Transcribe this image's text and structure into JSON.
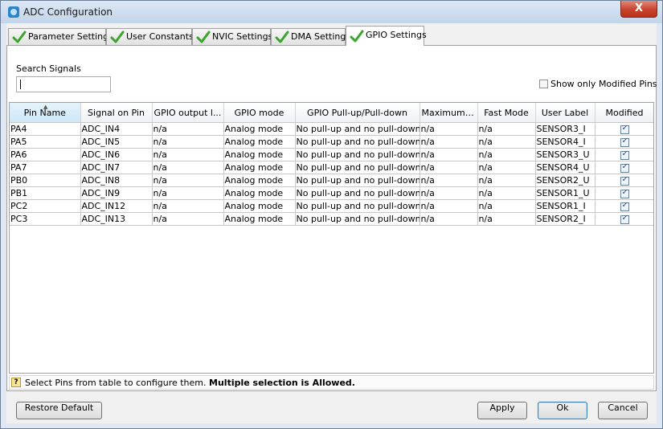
{
  "window": {
    "title": "ADC Configuration",
    "close_label": "X"
  },
  "tabs": [
    {
      "label": "Parameter Settings",
      "active": false
    },
    {
      "label": "User Constants",
      "active": false
    },
    {
      "label": "NVIC Settings",
      "active": false
    },
    {
      "label": "DMA Settings",
      "active": false
    },
    {
      "label": "GPIO Settings",
      "active": true
    }
  ],
  "search": {
    "label": "Search Signals",
    "value": ""
  },
  "show_modified": {
    "label": "Show only Modified Pins",
    "checked": false
  },
  "table": {
    "columns": [
      "Pin Name",
      "Signal on Pin",
      "GPIO output l...",
      "GPIO mode",
      "GPIO Pull-up/Pull-down",
      "Maximum ...",
      "Fast Mode",
      "User Label",
      "Modified"
    ],
    "sorted_column": "Pin Name",
    "rows": [
      {
        "pin": "PA4",
        "signal": "ADC_IN4",
        "output": "n/a",
        "mode": "Analog mode",
        "pull": "No pull-up and no pull-down",
        "max": "n/a",
        "fast": "n/a",
        "label": "SENSOR3_I",
        "modified": true
      },
      {
        "pin": "PA5",
        "signal": "ADC_IN5",
        "output": "n/a",
        "mode": "Analog mode",
        "pull": "No pull-up and no pull-down",
        "max": "n/a",
        "fast": "n/a",
        "label": "SENSOR4_I",
        "modified": true
      },
      {
        "pin": "PA6",
        "signal": "ADC_IN6",
        "output": "n/a",
        "mode": "Analog mode",
        "pull": "No pull-up and no pull-down",
        "max": "n/a",
        "fast": "n/a",
        "label": "SENSOR3_U",
        "modified": true
      },
      {
        "pin": "PA7",
        "signal": "ADC_IN7",
        "output": "n/a",
        "mode": "Analog mode",
        "pull": "No pull-up and no pull-down",
        "max": "n/a",
        "fast": "n/a",
        "label": "SENSOR4_U",
        "modified": true
      },
      {
        "pin": "PB0",
        "signal": "ADC_IN8",
        "output": "n/a",
        "mode": "Analog mode",
        "pull": "No pull-up and no pull-down",
        "max": "n/a",
        "fast": "n/a",
        "label": "SENSOR2_U",
        "modified": true
      },
      {
        "pin": "PB1",
        "signal": "ADC_IN9",
        "output": "n/a",
        "mode": "Analog mode",
        "pull": "No pull-up and no pull-down",
        "max": "n/a",
        "fast": "n/a",
        "label": "SENSOR1_U",
        "modified": true
      },
      {
        "pin": "PC2",
        "signal": "ADC_IN12",
        "output": "n/a",
        "mode": "Analog mode",
        "pull": "No pull-up and no pull-down",
        "max": "n/a",
        "fast": "n/a",
        "label": "SENSOR1_I",
        "modified": true
      },
      {
        "pin": "PC3",
        "signal": "ADC_IN13",
        "output": "n/a",
        "mode": "Analog mode",
        "pull": "No pull-up and no pull-down",
        "max": "n/a",
        "fast": "n/a",
        "label": "SENSOR2_I",
        "modified": true
      }
    ]
  },
  "hint": {
    "icon": "?",
    "text": "Select Pins from table to configure them. ",
    "bold": "Multiple selection is Allowed."
  },
  "buttons": {
    "restore": "Restore Default",
    "apply": "Apply",
    "ok": "Ok",
    "cancel": "Cancel"
  },
  "colors": {
    "check_green": "#3aa52c",
    "title_bar": "#c3d5ea",
    "close_red": "#c8432d"
  }
}
